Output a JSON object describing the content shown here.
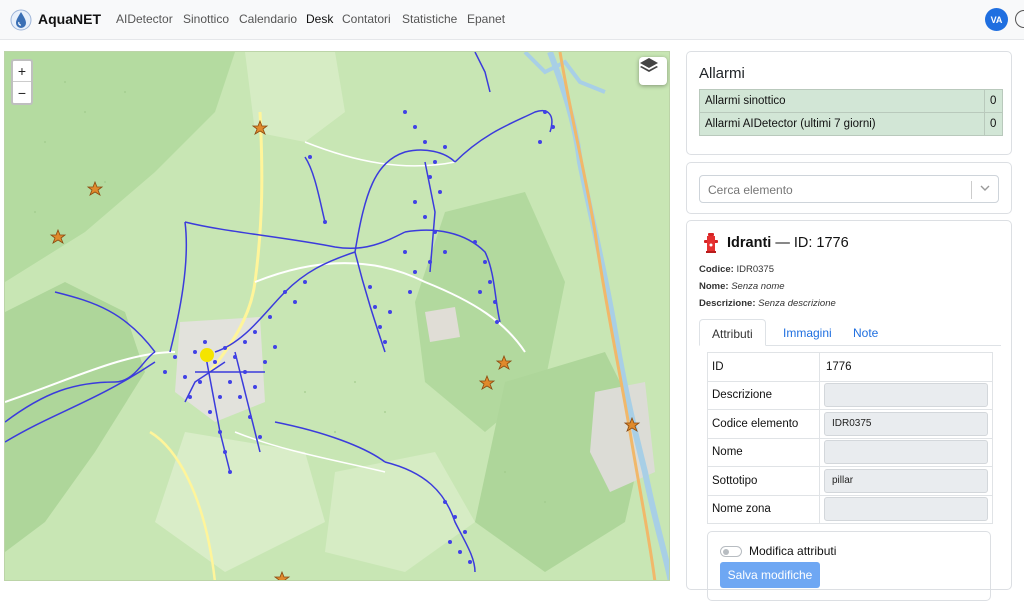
{
  "app": {
    "name": "AquaNET",
    "logo_icon": "water-drop-logo-icon"
  },
  "nav": {
    "items": [
      {
        "label": "AIDetector",
        "active": false
      },
      {
        "label": "Sinottico",
        "active": false
      },
      {
        "label": "Calendario",
        "active": false
      },
      {
        "label": "Desk",
        "active": true
      },
      {
        "label": "Contatori",
        "active": false
      },
      {
        "label": "Statistiche",
        "active": false
      },
      {
        "label": "Epanet",
        "active": false
      }
    ]
  },
  "user": {
    "initials": "VA"
  },
  "map": {
    "zoom_in": "+",
    "zoom_out": "−",
    "layers_icon": "layers-icon"
  },
  "alarms": {
    "title": "Allarmi",
    "rows": [
      {
        "label": "Allarmi sinottico",
        "count": "0"
      },
      {
        "label": "Allarmi AIDetector (ultimi 7 giorni)",
        "count": "0"
      }
    ],
    "row_color": "#d2e6d6"
  },
  "search": {
    "placeholder": "Cerca elemento"
  },
  "element": {
    "icon": "hydrant-icon",
    "type": "Idranti",
    "id_text": " — ID: 1776",
    "fields": [
      {
        "label": "Codice:",
        "value": "IDR0375",
        "italic": false
      },
      {
        "label": "Nome:",
        "value": "Senza nome",
        "italic": true
      },
      {
        "label": "Descrizione:",
        "value": "Senza descrizione",
        "italic": true
      }
    ],
    "tabs": [
      {
        "label": "Attributi",
        "active": true
      },
      {
        "label": "Immagini",
        "active": false
      },
      {
        "label": "Note",
        "active": false
      }
    ],
    "attributes": [
      {
        "label": "ID",
        "value": "1776",
        "editable": false
      },
      {
        "label": "Descrizione",
        "value": "",
        "editable": true
      },
      {
        "label": "Codice elemento",
        "value": "IDR0375",
        "editable": true
      },
      {
        "label": "Nome",
        "value": "",
        "editable": true
      },
      {
        "label": "Sottotipo",
        "value": "pillar",
        "editable": true
      },
      {
        "label": "Nome zona",
        "value": "",
        "editable": true
      }
    ],
    "edit_toggle_label": "Modifica attributi",
    "save_label": "Salva modifiche"
  },
  "colors": {
    "accent": "#1f6fe0",
    "network": "#3b3bdc",
    "map_bg": "#c8e6b4",
    "highlight": "#f5e400"
  }
}
